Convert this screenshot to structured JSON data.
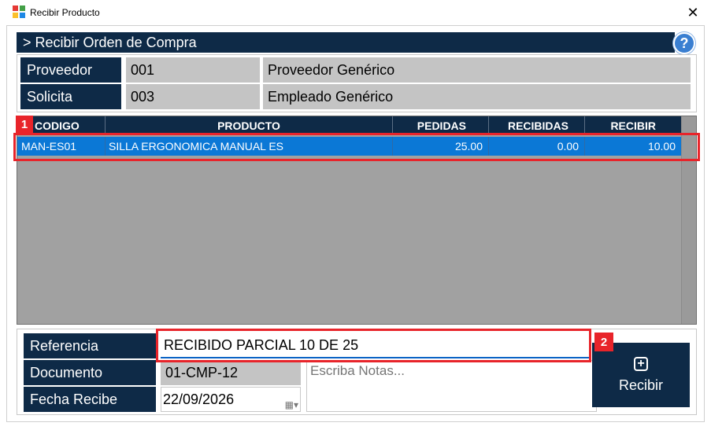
{
  "window": {
    "title": "Recibir Producto",
    "close_glyph": "✕"
  },
  "header": {
    "title": "> Recibir Orden de Compra",
    "help_glyph": "?"
  },
  "info": {
    "proveedor_label": "Proveedor",
    "proveedor_code": "001",
    "proveedor_name": "Proveedor Genérico",
    "solicita_label": "Solicita",
    "solicita_code": "003",
    "solicita_name": "Empleado Genérico"
  },
  "grid": {
    "columns": [
      "CODIGO",
      "PRODUCTO",
      "PEDIDAS",
      "RECIBIDAS",
      "RECIBIR"
    ],
    "rows": [
      {
        "codigo": "MAN-ES01",
        "producto": "SILLA ERGONOMICA MANUAL ES",
        "pedidas": "25.00",
        "recibidas": "0.00",
        "recibir": "10.00"
      }
    ]
  },
  "markers": {
    "one": "1",
    "two": "2"
  },
  "form": {
    "referencia_label": "Referencia",
    "referencia_value": "RECIBIDO PARCIAL 10 DE 25",
    "documento_label": "Documento",
    "documento_value": "01-CMP-12",
    "notes_placeholder": "Escriba Notas...",
    "fecha_label": "Fecha Recibe",
    "fecha_value": "22/09/2026"
  },
  "recibir_button": {
    "label": "Recibir"
  },
  "colors": {
    "navy": "#0e2a47",
    "selection": "#0b78d6",
    "highlight": "#e8242a"
  }
}
